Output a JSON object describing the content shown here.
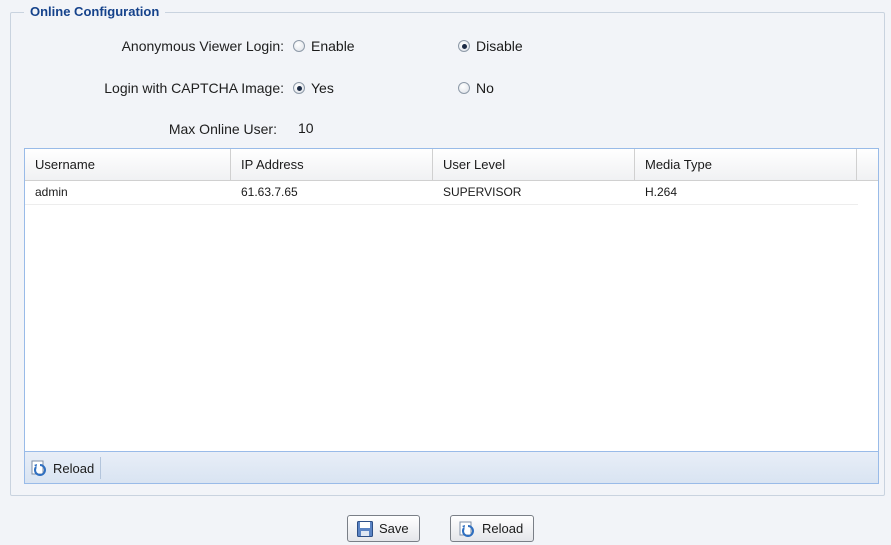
{
  "section": {
    "legend": "Online Configuration"
  },
  "form": {
    "anonymous_login": {
      "label": "Anonymous Viewer Login:",
      "options": [
        "Enable",
        "Disable"
      ],
      "selected": "Disable"
    },
    "captcha_login": {
      "label": "Login with CAPTCHA Image:",
      "options": [
        "Yes",
        "No"
      ],
      "selected": "Yes"
    },
    "max_online_user": {
      "label": "Max Online User:",
      "value": "10"
    }
  },
  "grid": {
    "columns": [
      "Username",
      "IP Address",
      "User Level",
      "Media Type"
    ],
    "rows": [
      [
        "admin",
        "61.63.7.65",
        "SUPERVISOR",
        "H.264"
      ]
    ],
    "toolbar": {
      "reload_label": "Reload",
      "reload_icon": "reload-icon"
    }
  },
  "buttons": {
    "save_label": "Save",
    "save_icon": "save-icon",
    "reload_label": "Reload",
    "reload_icon": "reload-icon"
  },
  "colors": {
    "legend": "#15428b",
    "grid_border": "#99bbe8",
    "toolbar_bg": "#d9e4f2"
  }
}
